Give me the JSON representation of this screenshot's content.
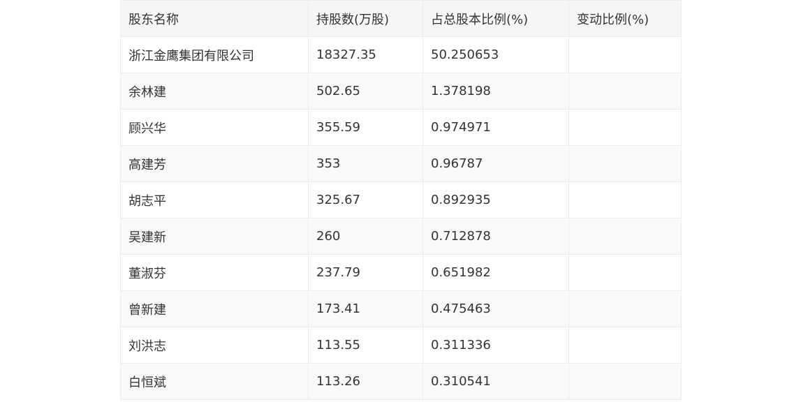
{
  "table": {
    "headers": [
      "股东名称",
      "持股数(万股)",
      "占总股本比例(%)",
      "变动比例(%)"
    ],
    "rows": [
      [
        "浙江金鹰集团有限公司",
        "18327.35",
        "50.250653",
        ""
      ],
      [
        "余林建",
        "502.65",
        "1.378198",
        ""
      ],
      [
        "顾兴华",
        "355.59",
        "0.974971",
        ""
      ],
      [
        "高建芳",
        "353",
        "0.96787",
        ""
      ],
      [
        "胡志平",
        "325.67",
        "0.892935",
        ""
      ],
      [
        "吴建新",
        "260",
        "0.712878",
        ""
      ],
      [
        "董淑芬",
        "237.79",
        "0.651982",
        ""
      ],
      [
        "曾新建",
        "173.41",
        "0.475463",
        ""
      ],
      [
        "刘洪志",
        "113.55",
        "0.311336",
        ""
      ],
      [
        "白恒斌",
        "113.26",
        "0.310541",
        ""
      ]
    ]
  }
}
